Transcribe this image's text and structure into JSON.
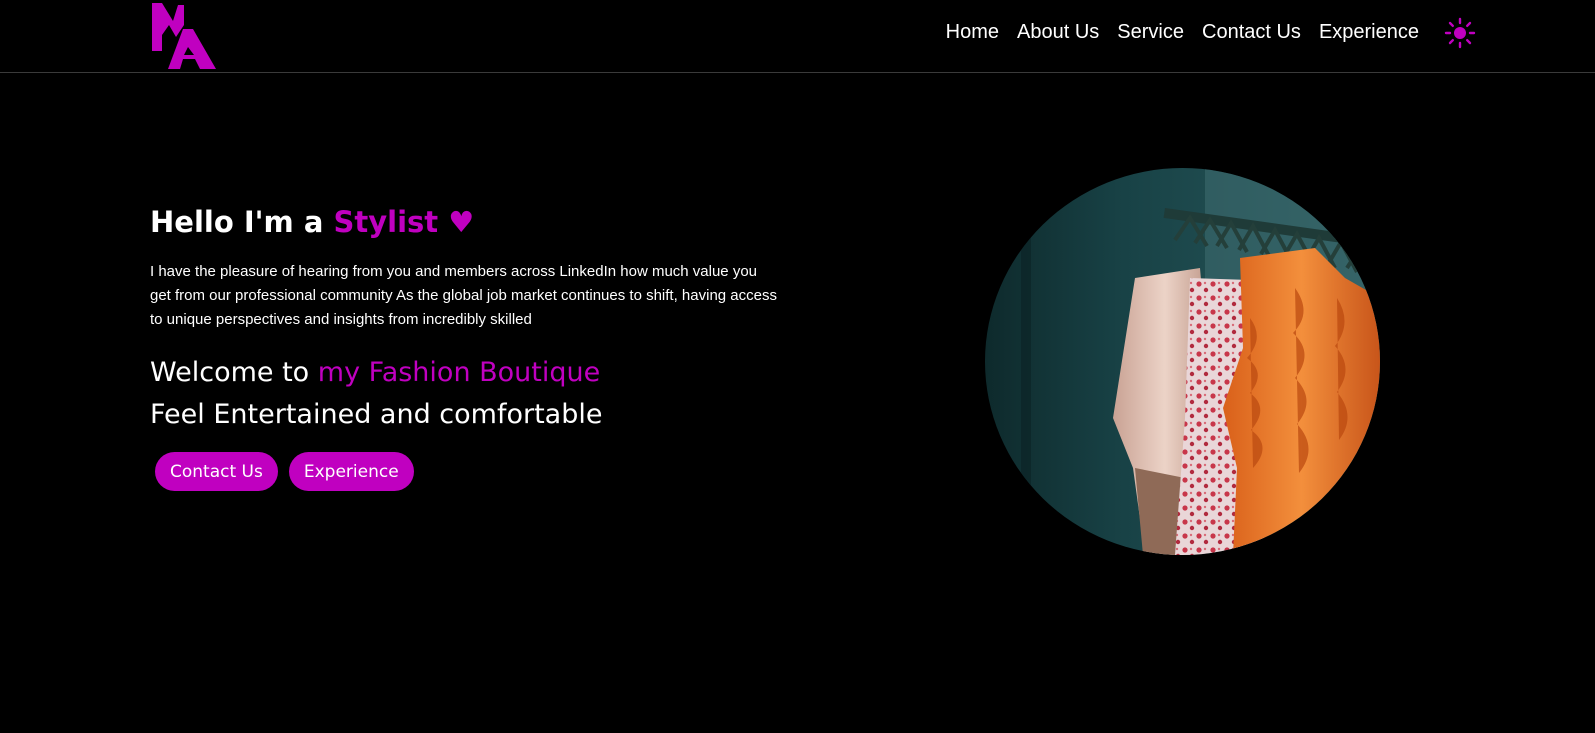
{
  "nav": {
    "logo_text": "MA",
    "links": [
      "Home",
      "About Us",
      "Service",
      "Contact Us",
      "Experience"
    ],
    "theme_icon": "sun-icon"
  },
  "hero": {
    "greeting_prefix": "Hello I'm a ",
    "greeting_role": "Stylist",
    "heart_symbol": "♥",
    "description": "I have the pleasure of hearing from you and members across LinkedIn how much value you get from our professional community As the global job market continues to shift, having access to unique perspectives and insights from incredibly skilled",
    "welcome_prefix": "Welcome to ",
    "welcome_name": "my Fashion Boutique",
    "tagline": "Feel Entertained and comfortable",
    "buttons": [
      "Contact Us",
      "Experience"
    ],
    "image_subject": "clothing rack with garments"
  },
  "colors": {
    "background": "#000000",
    "accent": "#c000c0",
    "text": "#ffffff"
  }
}
